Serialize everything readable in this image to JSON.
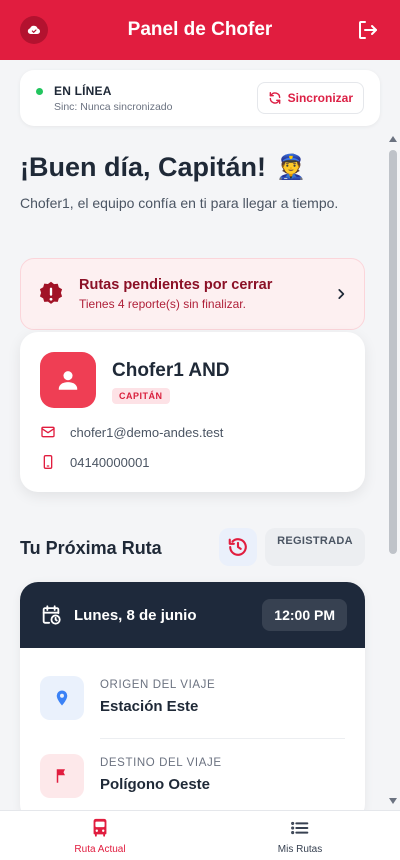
{
  "header": {
    "title": "Panel de Chofer"
  },
  "connection": {
    "status": "EN LÍNEA",
    "sync_info": "Sinc: Nunca sincronizado",
    "sync_button": "Sincronizar",
    "status_color": "#22c55e"
  },
  "greeting": {
    "title": "¡Buen día, Capitán!",
    "emoji": "👮",
    "subtitle": "Chofer1, el equipo confía en ti para llegar a tiempo."
  },
  "alert": {
    "title": "Rutas pendientes por cerrar",
    "subtitle": "Tienes 4 reporte(s) sin finalizar."
  },
  "profile": {
    "name": "Chofer1 AND",
    "role": "CAPITÁN",
    "email": "chofer1@demo-andes.test",
    "phone": "04140000001"
  },
  "route": {
    "section_title": "Tu Próxima Ruta",
    "status": "REGISTRADA",
    "date": "Lunes, 8 de junio",
    "time": "12:00 PM",
    "origin_label": "ORIGEN DEL VIAJE",
    "origin_value": "Estación Este",
    "destination_label": "DESTINO DEL VIAJE",
    "destination_value": "Polígono Oeste"
  },
  "nav": {
    "current": "Ruta Actual",
    "my_routes": "Mis Rutas"
  },
  "colors": {
    "brand": "#e11d3f",
    "route_header": "#1e293b"
  }
}
